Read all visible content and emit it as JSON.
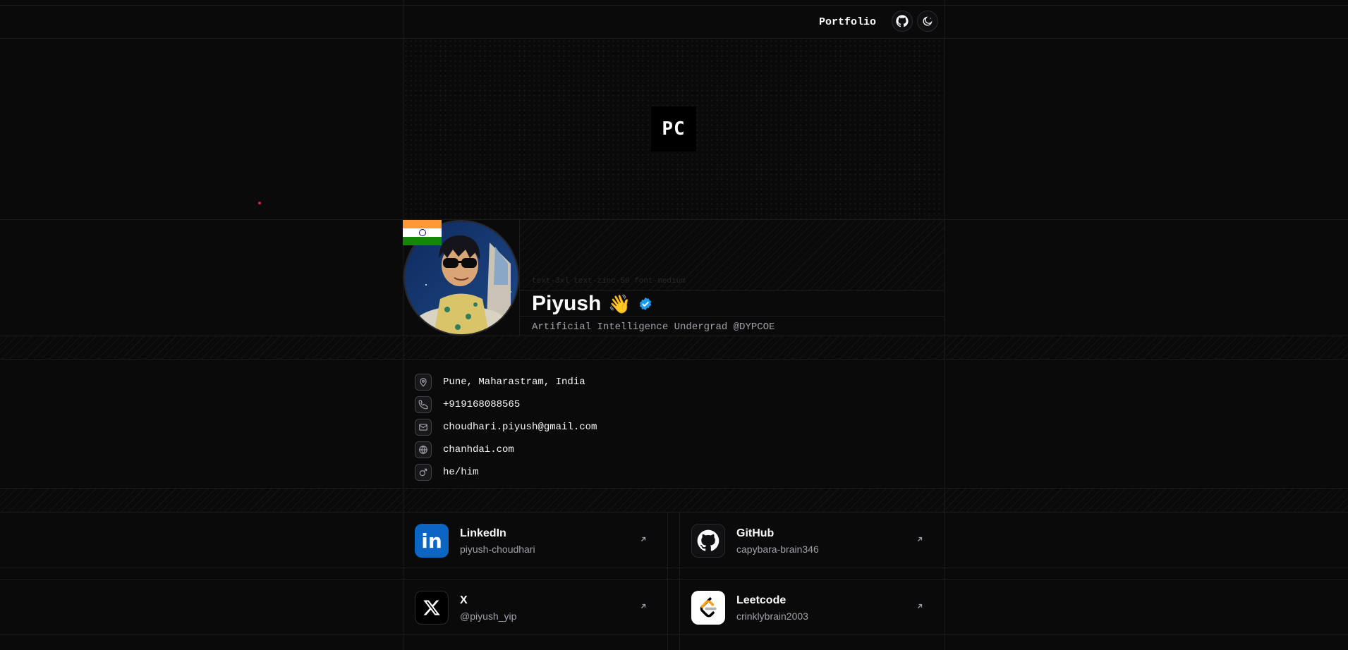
{
  "nav": {
    "portfolio_label": "Portfolio"
  },
  "logo": {
    "text": "PC"
  },
  "profile": {
    "ghost_text": "text-3xl text-zinc-50 font-medium",
    "name": "Piyush",
    "wave": "👋",
    "tagline": "Artificial Intelligence Undergrad @DYPCOE"
  },
  "details": [
    {
      "icon": "map-pin-icon",
      "text": "Pune, Maharastram, India"
    },
    {
      "icon": "phone-icon",
      "text": "+919168088565"
    },
    {
      "icon": "mail-icon",
      "text": "choudhari.piyush@gmail.com"
    },
    {
      "icon": "globe-icon",
      "text": "chanhdai.com"
    },
    {
      "icon": "mars-icon",
      "text": "he/him"
    }
  ],
  "socials": [
    {
      "name": "LinkedIn",
      "handle": "piyush-choudhari",
      "color": "#0a66c2"
    },
    {
      "name": "GitHub",
      "handle": "capybara-brain346",
      "color": "#111113"
    },
    {
      "name": "X",
      "handle": "@piyush_yip",
      "color": "#000000"
    },
    {
      "name": "Leetcode",
      "handle": "crinklybrain2003",
      "color": "#ffffff"
    }
  ],
  "flag_colors": [
    "#ff9933",
    "#ffffff",
    "#138808"
  ]
}
